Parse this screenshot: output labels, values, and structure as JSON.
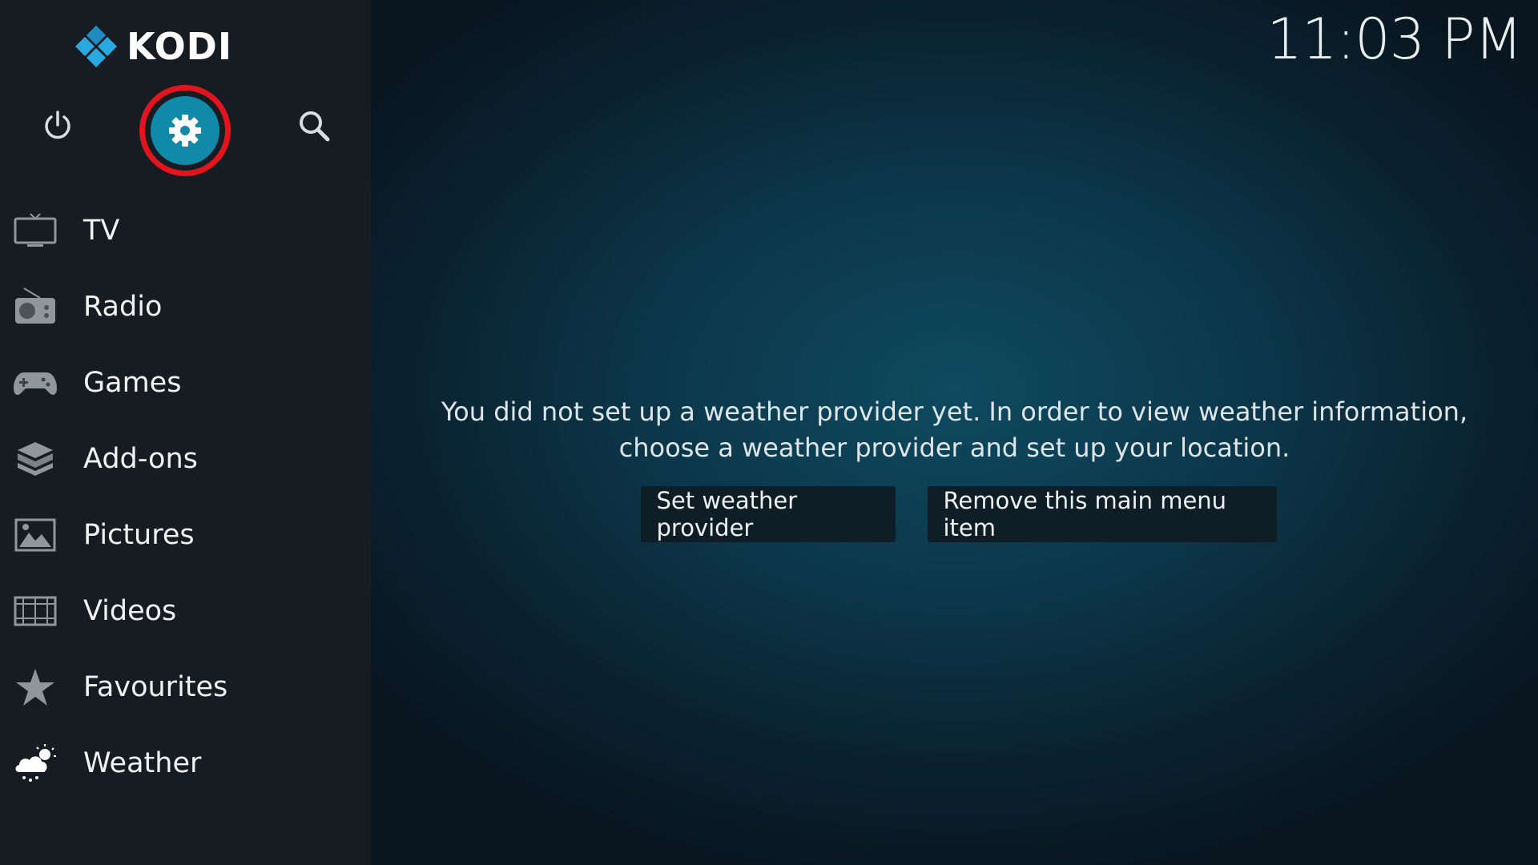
{
  "app": {
    "logo_text": "KODI",
    "clock": "11:03 PM"
  },
  "colors": {
    "sidebar_bg": "#171c22",
    "accent": "#1189a8",
    "highlight_ring": "#e2151f",
    "logo_blue": "#29a9e0"
  },
  "top_controls": {
    "power_icon": "power-icon",
    "settings_icon": "gear-icon",
    "search_icon": "search-icon"
  },
  "menu": {
    "items": [
      {
        "label": "TV",
        "icon": "tv-icon"
      },
      {
        "label": "Radio",
        "icon": "radio-icon"
      },
      {
        "label": "Games",
        "icon": "gamepad-icon"
      },
      {
        "label": "Add-ons",
        "icon": "addons-box-icon"
      },
      {
        "label": "Pictures",
        "icon": "picture-icon"
      },
      {
        "label": "Videos",
        "icon": "film-icon"
      },
      {
        "label": "Favourites",
        "icon": "star-icon"
      },
      {
        "label": "Weather",
        "icon": "weather-cloud-sun-icon"
      }
    ]
  },
  "main": {
    "message": "You did not set up a weather provider yet. In order to view weather information, choose a weather provider and set up your location.",
    "buttons": {
      "set_provider": "Set weather provider",
      "remove_item": "Remove this main menu item"
    }
  }
}
